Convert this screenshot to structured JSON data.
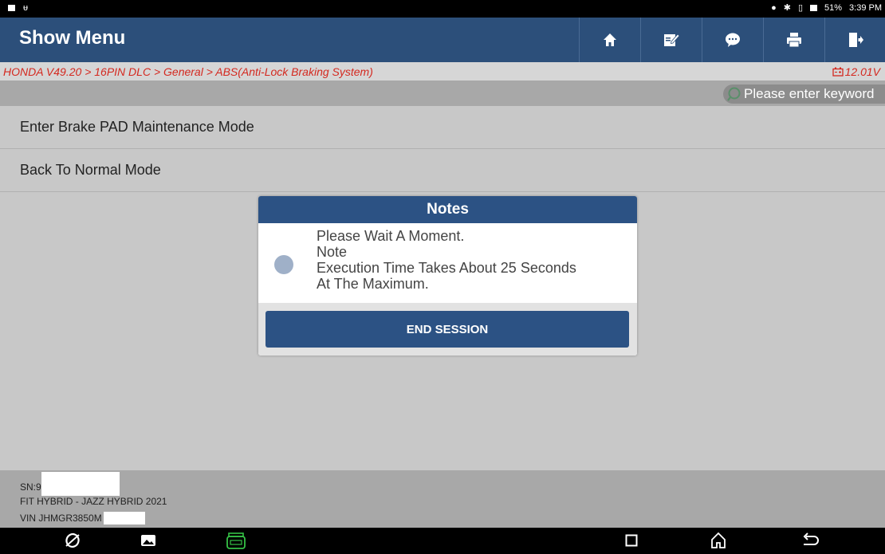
{
  "status_bar": {
    "battery": "51%",
    "time": "3:39 PM"
  },
  "header": {
    "title": "Show Menu",
    "buttons": [
      {
        "icon": "home-icon"
      },
      {
        "icon": "edit-icon"
      },
      {
        "icon": "chat-icon"
      },
      {
        "icon": "print-icon"
      },
      {
        "icon": "exit-icon"
      }
    ]
  },
  "breadcrumb": {
    "path": "HONDA V49.20 > 16PIN DLC > General > ABS(Anti-Lock Braking System)",
    "voltage": "12.01V"
  },
  "search": {
    "placeholder": "Please enter keyword"
  },
  "menu": {
    "items": [
      {
        "label": "Enter Brake PAD Maintenance Mode"
      },
      {
        "label": "Back To Normal Mode"
      }
    ]
  },
  "dialog": {
    "title": "Notes",
    "lines": [
      "Please Wait A Moment.",
      "Note",
      "Execution Time Takes About 25 Seconds",
      "At The Maximum."
    ],
    "button_label": "END SESSION"
  },
  "vehicle_info": {
    "sn_label": "SN:9",
    "model": "FIT HYBRID - JAZZ HYBRID 2021",
    "vin_label": "VIN JHMGR3850M"
  },
  "colors": {
    "header_bg": "#2c4f7a",
    "accent": "#2c5284",
    "breadcrumb_text": "#d4281f",
    "page_bg": "#c8c8c8"
  }
}
